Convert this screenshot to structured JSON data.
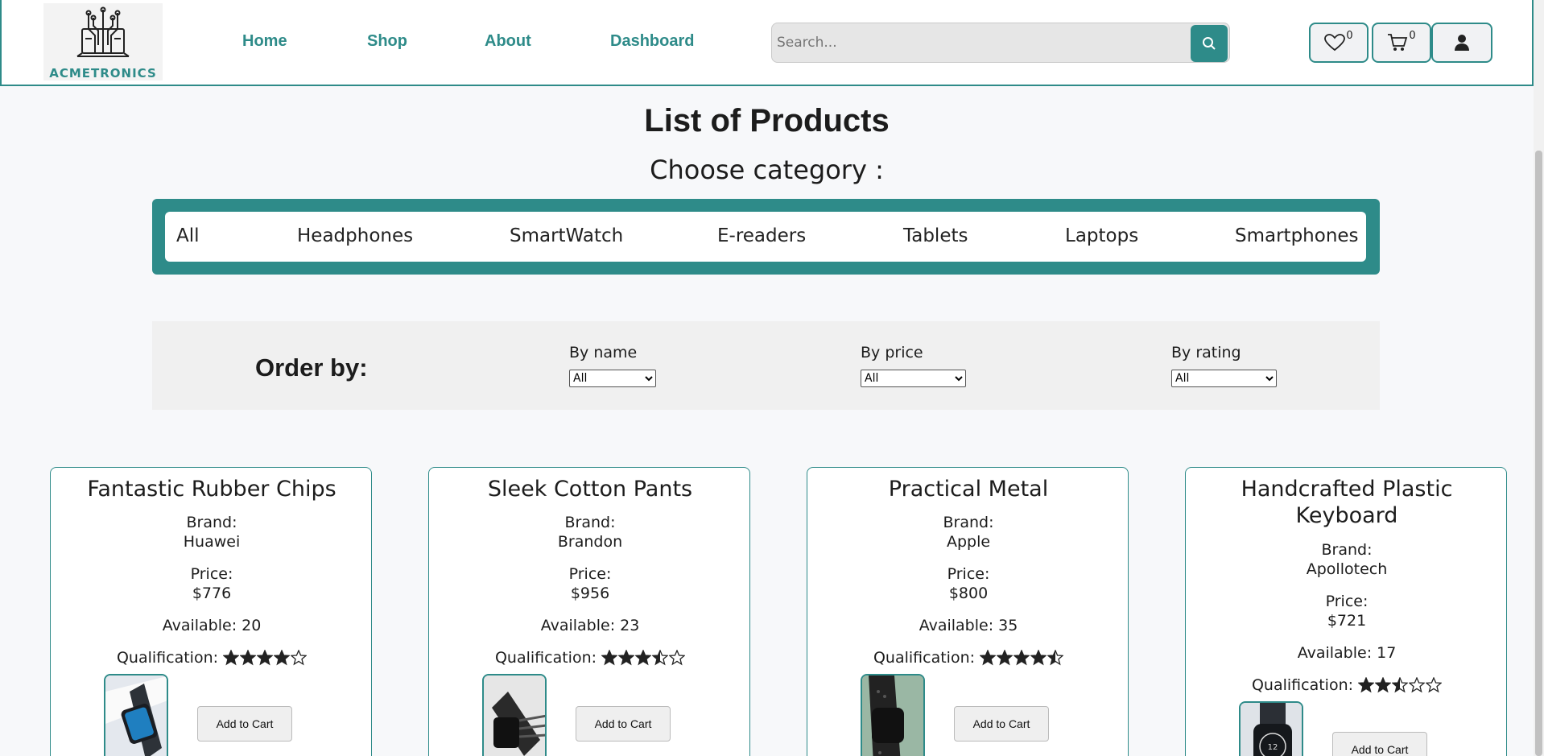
{
  "header": {
    "logo_text": "ACMETRONICS",
    "nav": [
      "Home",
      "Shop",
      "About",
      "Dashboard"
    ],
    "search_placeholder": "Search...",
    "wishlist_count": "0",
    "cart_count": "0"
  },
  "main": {
    "title": "List of Products",
    "choose_label": "Choose category :",
    "categories": [
      "All",
      "Headphones",
      "SmartWatch",
      "E-readers",
      "Tablets",
      "Laptops",
      "Smartphones"
    ]
  },
  "order": {
    "title": "Order by:",
    "by_name": {
      "label": "By name",
      "value": "All"
    },
    "by_price": {
      "label": "By price",
      "value": "All"
    },
    "by_rating": {
      "label": "By rating",
      "value": "All"
    }
  },
  "products": [
    {
      "name": "Fantastic Rubber Chips",
      "brand_label": "Brand:",
      "brand": "Huawei",
      "price_label": "Price:",
      "price": "$776",
      "available": "Available: 20",
      "qual_label": "Qualification:",
      "rating": 4,
      "button": "Add to Cart"
    },
    {
      "name": "Sleek Cotton Pants",
      "brand_label": "Brand:",
      "brand": "Brandon",
      "price_label": "Price:",
      "price": "$956",
      "available": "Available: 23",
      "qual_label": "Qualification:",
      "rating": 3.5,
      "button": "Add to Cart"
    },
    {
      "name": "Practical Metal",
      "brand_label": "Brand:",
      "brand": "Apple",
      "price_label": "Price:",
      "price": "$800",
      "available": "Available: 35",
      "qual_label": "Qualification:",
      "rating": 4.5,
      "button": "Add to Cart"
    },
    {
      "name": "Handcrafted Plastic Keyboard",
      "brand_label": "Brand:",
      "brand": "Apollotech",
      "price_label": "Price:",
      "price": "$721",
      "available": "Available: 17",
      "qual_label": "Qualification:",
      "rating": 2.5,
      "button": "Add to Cart"
    }
  ],
  "colors": {
    "accent": "#2e8b89",
    "background": "#f7f8fa"
  }
}
